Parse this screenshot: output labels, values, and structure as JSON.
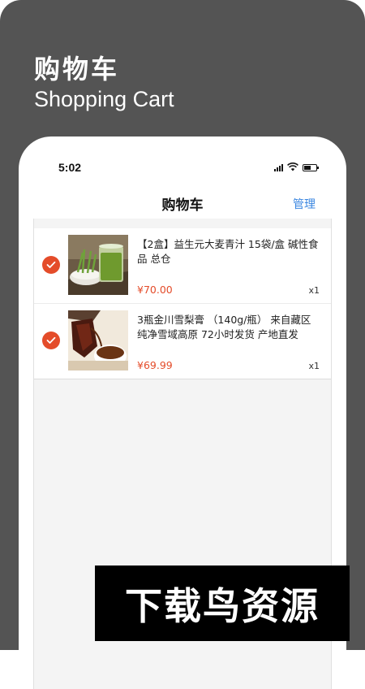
{
  "promo": {
    "title_cn": "购物车",
    "title_en": "Shopping Cart"
  },
  "status_bar": {
    "time": "5:02",
    "icons": [
      "cellular-signal-icon",
      "wifi-icon",
      "battery-icon"
    ]
  },
  "nav": {
    "title": "购物车",
    "manage_label": "管理"
  },
  "cart": {
    "items": [
      {
        "checked": true,
        "image": "green-juice-glass-image",
        "title": "【2盒】益生元大麦青汁 15袋/盒 碱性食品 总仓",
        "price": "¥70.00",
        "qty": "x1"
      },
      {
        "checked": true,
        "image": "honey-syrup-pouring-image",
        "title": "3瓶金川雪梨膏 （140g/瓶） 来自藏区纯净雪域高原  72小时发货 产地直发",
        "price": "¥69.99",
        "qty": "x1"
      }
    ]
  },
  "watermark": {
    "text": "下载鸟资源"
  },
  "colors": {
    "accent_red": "#e44c2a",
    "link_blue": "#3a86e0",
    "promo_bg": "#545454"
  }
}
